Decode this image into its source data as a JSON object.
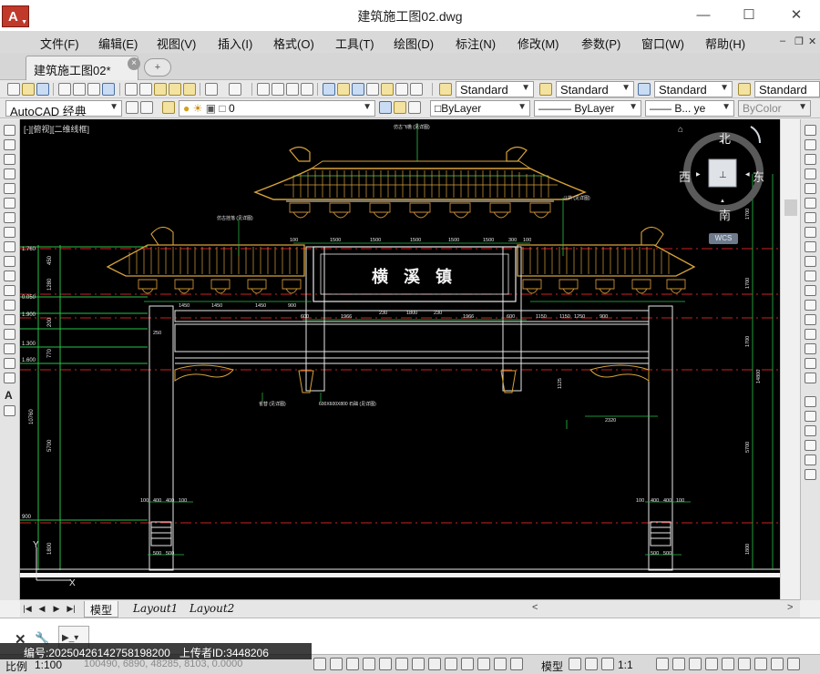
{
  "window": {
    "title": "建筑施工图02.dwg"
  },
  "menubar": {
    "items": [
      "文件(F)",
      "编辑(E)",
      "视图(V)",
      "插入(I)",
      "格式(O)",
      "工具(T)",
      "绘图(D)",
      "标注(N)",
      "修改(M)",
      "参数(P)",
      "窗口(W)",
      "帮助(H)"
    ]
  },
  "tabs": {
    "document_tab": "建筑施工图02*"
  },
  "toolbar": {
    "text_style": "Standard",
    "dim_style": "Standard",
    "table_style": "Standard",
    "multileader_style": "Standard"
  },
  "layers": {
    "workspace": "AutoCAD 经典",
    "current_layer": "0",
    "color": "ByLayer",
    "linetype": "ByLayer",
    "lineweight": "B... ye",
    "plot_style": "ByColor"
  },
  "viewport": {
    "view_label": "[-][俯视][二维线框]",
    "viewcube": {
      "north": "北",
      "south": "南",
      "east": "东",
      "west": "西"
    },
    "wcs_label": "WCS"
  },
  "drawing": {
    "plaque_text": "横 溪 镇",
    "top_dimensions": [
      "100",
      "1500",
      "1500",
      "1500",
      "1500",
      "1500",
      "300",
      "100"
    ],
    "mid_dimensions": [
      "1450",
      "1450",
      "1450",
      "900",
      "600",
      "1966",
      "230",
      "1800",
      "230",
      "1966",
      "600",
      "1150",
      "1150",
      "1250",
      "900"
    ],
    "pillar_dimensions": [
      "100",
      "400",
      "400",
      "100",
      "500",
      "500"
    ],
    "left_elevations": [
      "1.760",
      "0.050",
      "1.900",
      "1.300",
      "1.600",
      "450",
      "1280",
      "200",
      "770",
      "10760",
      "5700",
      "900",
      "1800"
    ],
    "right_elevations": [
      "1700",
      "1700",
      "14800",
      "1700",
      "5700",
      "1800"
    ],
    "other_dims": [
      "2320",
      "1125",
      "250"
    ],
    "notes": [
      "600X600X800 石础 (见详图)",
      "仿古飞檐 (见详图)",
      "斗拱 (见详图)",
      "仿古挂落 (见详图)",
      "雀替 (见详图)"
    ]
  },
  "layout_tabs": {
    "model": "模型",
    "layout1": "Layout1",
    "layout2": "Layout2"
  },
  "watermark": {
    "id_label": "编号:",
    "id_value": "20250426142758198200",
    "uploader_label": "上传者ID:",
    "uploader_value": "3448206"
  },
  "statusbar": {
    "scale_label": "比例",
    "scale_value": "1:100",
    "coordinates": "100490, 6890, 48285, 8103, 0.0000",
    "model_label": "模型",
    "annotation_scale": "1:1"
  }
}
